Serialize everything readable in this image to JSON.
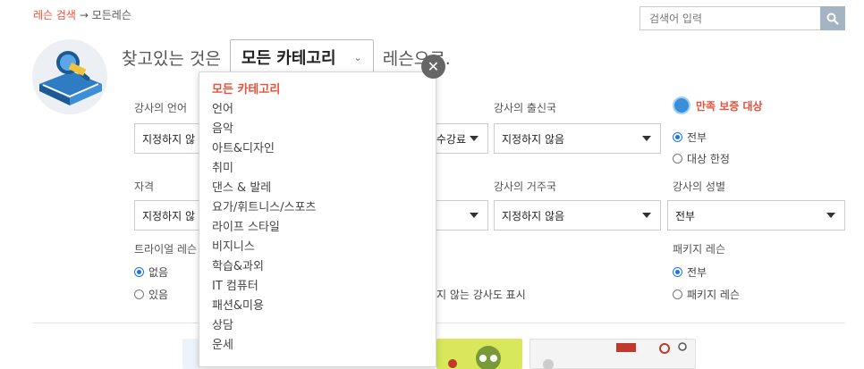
{
  "breadcrumb": {
    "link": "레슨 검색",
    "arrow": "→",
    "current": "모든레슨"
  },
  "search": {
    "placeholder": "검색어 입력"
  },
  "headline": {
    "prefix": "찾고있는 것은",
    "category": "모든 카테고리",
    "suffix": "레슨으로."
  },
  "filters": {
    "teacher_language": {
      "label": "강사의 언어",
      "value": "지정하지 않"
    },
    "price": {
      "value": "수강료"
    },
    "origin": {
      "label": "강사의 출신국",
      "value": "지정하지 않음"
    },
    "guarantee": {
      "label": "만족 보증 대상",
      "options": [
        "전부",
        "대상 한정"
      ],
      "selected": 0
    },
    "qualification": {
      "label": "자격",
      "value": "지정하지 않"
    },
    "residence": {
      "label": "강사의 거주국",
      "value": "지정하지 않음"
    },
    "gender": {
      "label": "강사의 성별",
      "value": "전부"
    },
    "trial": {
      "label": "트라이얼 레슨",
      "options": [
        "없음",
        "있음"
      ],
      "selected": 0
    },
    "hidden_teachers": {
      "text": "지 않는 강사도 표시"
    },
    "package": {
      "label": "패키지 레슨",
      "options": [
        "전부",
        "패키지 레슨"
      ],
      "selected": 0
    }
  },
  "dropdown": {
    "items": [
      "모든 카테고리",
      "언어",
      "음악",
      "아트&디자인",
      "취미",
      "댄스 & 발레",
      "요가/휘트니스/스포츠",
      "라이프 스타일",
      "비지니스",
      "학습&과외",
      "IT 컴퓨터",
      "패션&미용",
      "상담",
      "운세"
    ],
    "active_index": 0
  },
  "colors": {
    "accent": "#e8503a",
    "radio": "#1a73e8",
    "search_button": "#a5b4c2"
  }
}
